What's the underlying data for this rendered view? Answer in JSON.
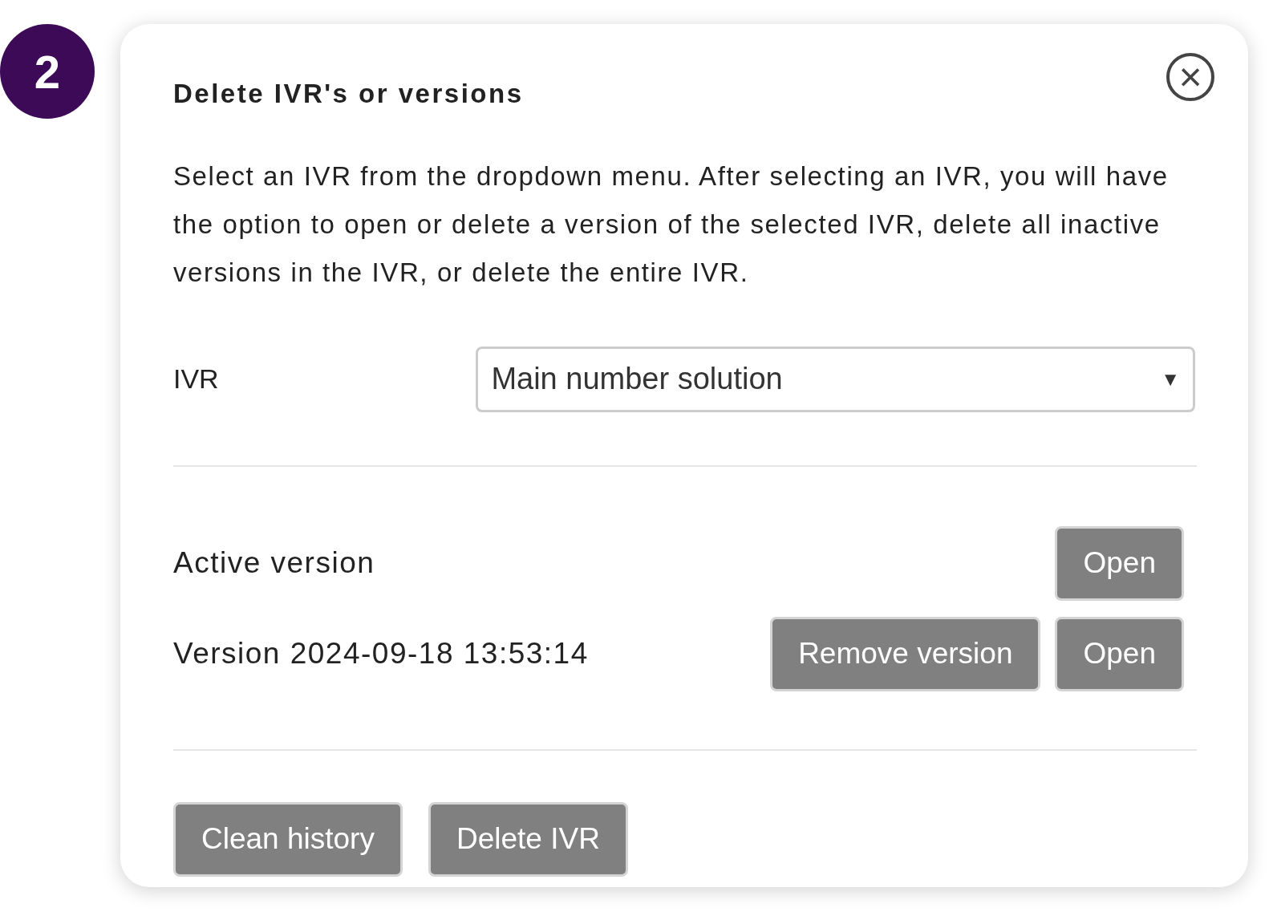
{
  "step_badge": "2",
  "dialog": {
    "title": "Delete IVR's or versions",
    "close_icon": "×",
    "description": "Select an IVR from the dropdown menu. After selecting an IVR, you will have the option to open or delete a version of the selected IVR, delete all inactive versions in the IVR, or delete the entire IVR.",
    "ivr_field": {
      "label": "IVR",
      "value": "Main number solution",
      "arrow": "▼"
    },
    "versions": [
      {
        "label": "Active version",
        "buttons": [
          "Open"
        ]
      },
      {
        "label": "Version 2024-09-18 13:53:14",
        "buttons": [
          "Remove version",
          "Open"
        ]
      }
    ],
    "actions": [
      "Clean history",
      "Delete IVR"
    ]
  }
}
